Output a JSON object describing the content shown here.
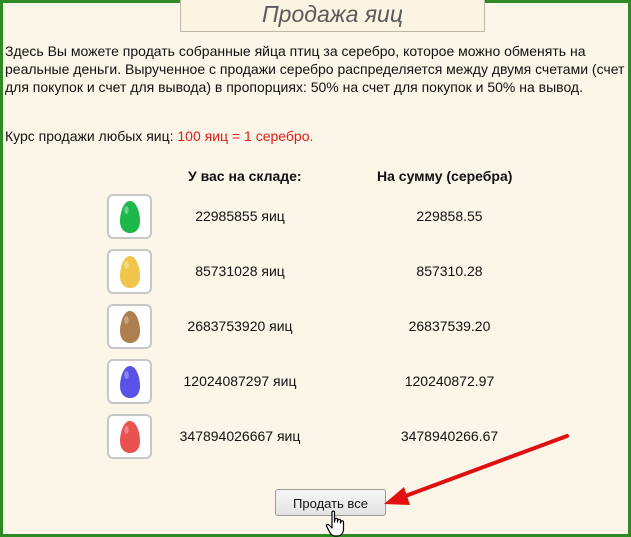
{
  "header": {
    "title": "Продажа яиц"
  },
  "description": "Здесь Вы можете продать собранные яйца птиц за серебро, которое можно обменять на реальные деньги. Вырученное с продажи серебро распределяется между двумя счетами (счет для покупок и счет для вывода) в пропорциях: 50% на счет для покупок и 50% на вывод.",
  "rate": {
    "label": "Курс продажи любых яиц:",
    "value": "100 яиц = 1 серебро."
  },
  "table": {
    "headers": {
      "stock": "У вас на складе:",
      "amount": "На сумму (серебра)"
    },
    "rows": [
      {
        "egg": "green-egg-icon",
        "color": "#1db84a",
        "quantity": "22985855 яиц",
        "amount": "229858.55"
      },
      {
        "egg": "yellow-egg-icon",
        "color": "#efc64a",
        "quantity": "85731028 яиц",
        "amount": "857310.28"
      },
      {
        "egg": "brown-egg-icon",
        "color": "#ad7f4f",
        "quantity": "2683753920 яиц",
        "amount": "26837539.20"
      },
      {
        "egg": "blue-egg-icon",
        "color": "#5a52e8",
        "quantity": "12024087297 яиц",
        "amount": "120240872.97"
      },
      {
        "egg": "red-egg-icon",
        "color": "#ea5252",
        "quantity": "347894026667 яиц",
        "amount": "3478940266.67"
      }
    ]
  },
  "actions": {
    "sell_all": "Продать все"
  },
  "colors": {
    "frame": "#2e8b24",
    "background": "#fbf6e7",
    "rate_value": "#e01b1b",
    "arrow": "#e01010"
  }
}
